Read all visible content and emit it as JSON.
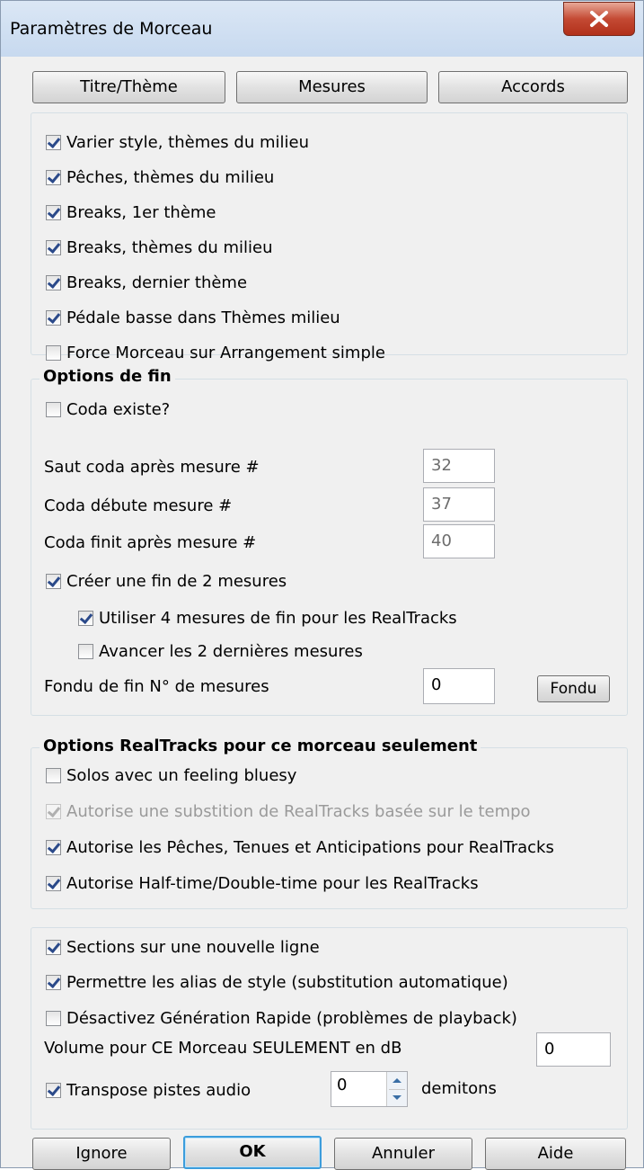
{
  "window": {
    "title": "Paramètres de Morceau"
  },
  "top_buttons": {
    "title_theme": "Titre/Thème",
    "bars": "Mesures",
    "chords": "Accords"
  },
  "general_options": [
    {
      "label": "Varier style, thèmes du milieu",
      "checked": true
    },
    {
      "label": "Pêches, thèmes du milieu",
      "checked": true
    },
    {
      "label": "Breaks, 1er thème",
      "checked": true
    },
    {
      "label": "Breaks, thèmes du milieu",
      "checked": true
    },
    {
      "label": "Breaks, dernier thème",
      "checked": true
    },
    {
      "label": "Pédale basse dans Thèmes milieu",
      "checked": true
    },
    {
      "label": "Force Morceau sur Arrangement simple",
      "checked": false
    }
  ],
  "ending": {
    "title": "Options de fin",
    "coda_exists": {
      "label": "Coda existe?",
      "checked": false
    },
    "coda_jump": {
      "label": "Saut coda après mesure #",
      "value": "32"
    },
    "coda_start": {
      "label": "Coda débute mesure #",
      "value": "37"
    },
    "coda_end": {
      "label": "Coda finit après mesure #",
      "value": "40"
    },
    "two_bar_ending": {
      "label": "Créer une fin de 2 mesures",
      "checked": true
    },
    "four_bar_realtracks": {
      "label": "Utiliser 4 mesures de fin pour les RealTracks",
      "checked": true
    },
    "push_last_bars": {
      "label": "Avancer les 2 dernières mesures",
      "checked": false
    },
    "fade_bars": {
      "label": "Fondu de fin N° de mesures",
      "value": "0"
    },
    "fade_button": "Fondu"
  },
  "realtracks": {
    "title": "Options RealTracks pour ce morceau seulement",
    "options": [
      {
        "label": "Solos avec un feeling bluesy",
        "checked": false,
        "disabled": false
      },
      {
        "label": "Autorise une substition de RealTracks basée sur le tempo",
        "checked": true,
        "disabled": true
      },
      {
        "label": "Autorise les Pêches, Tenues et Anticipations pour RealTracks",
        "checked": true,
        "disabled": false
      },
      {
        "label": "Autorise Half-time/Double-time pour les RealTracks",
        "checked": true,
        "disabled": false
      }
    ]
  },
  "misc": {
    "sections_new_line": {
      "label": "Sections sur une nouvelle ligne",
      "checked": true
    },
    "style_alias": {
      "label": "Permettre les alias de style (substitution automatique)",
      "checked": true
    },
    "fast_generation": {
      "label": "Désactivez Génération Rapide  (problèmes de playback)",
      "checked": false
    },
    "volume": {
      "label": "Volume pour CE Morceau SEULEMENT en dB",
      "value": "0"
    },
    "transpose": {
      "label": "Transpose pistes audio",
      "checked": true,
      "value": "0",
      "unit": "demitons"
    }
  },
  "bottom_buttons": {
    "ignore": "Ignore",
    "ok": "OK",
    "cancel": "Annuler",
    "help": "Aide"
  }
}
